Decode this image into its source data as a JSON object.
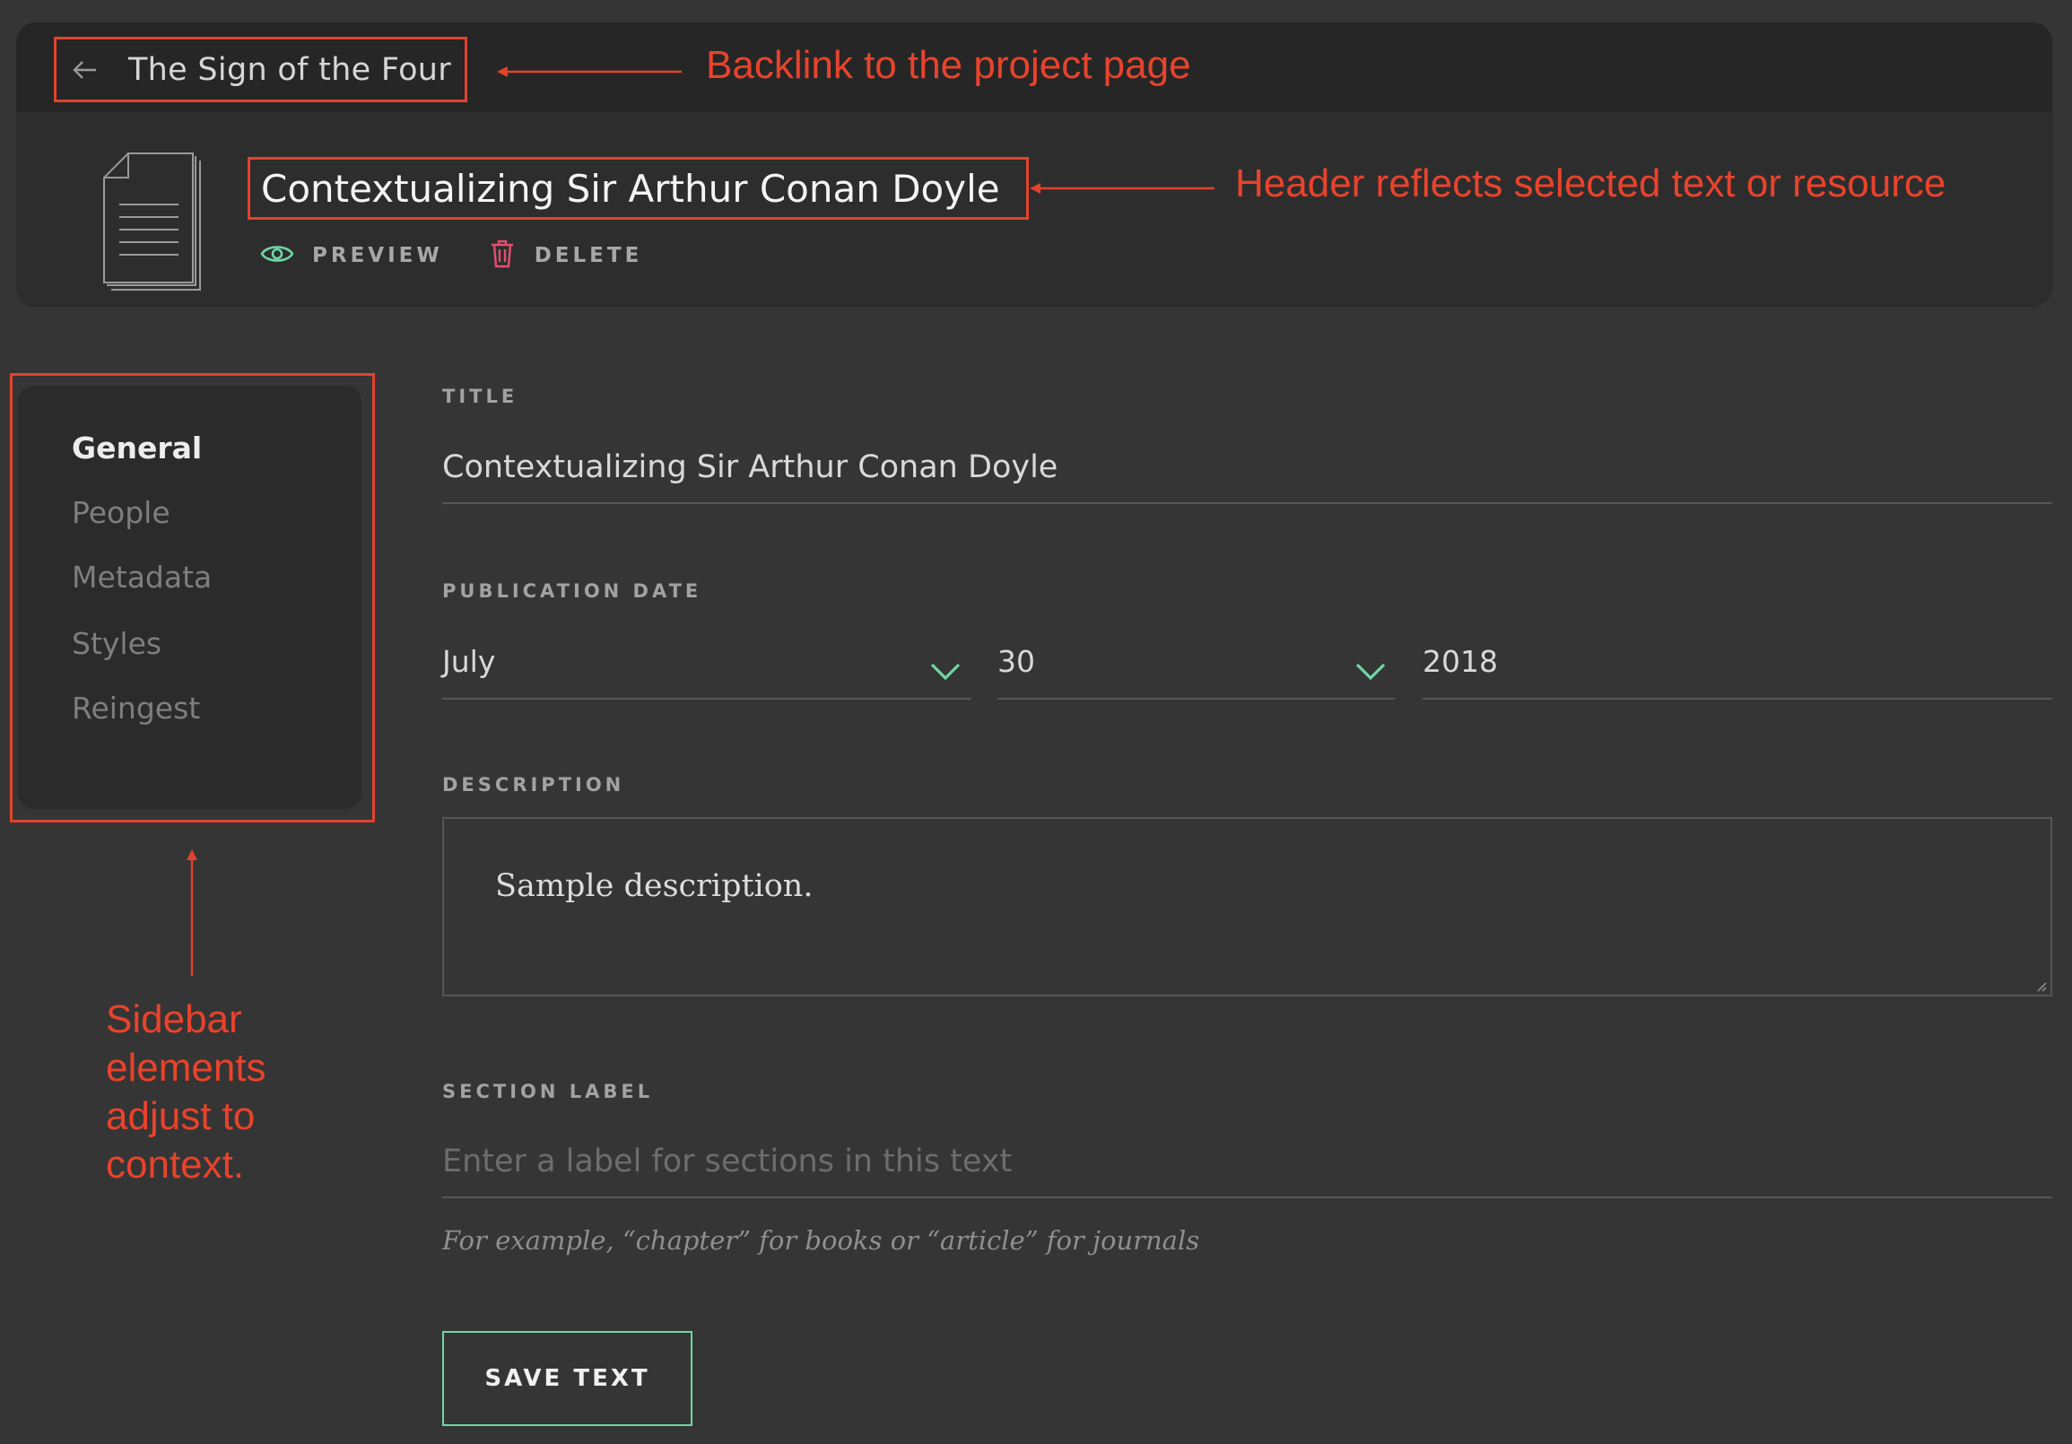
{
  "header": {
    "backlink_label": "The Sign of the Four",
    "title": "Contextualizing Sir Arthur Conan Doyle",
    "actions": {
      "preview_label": "PREVIEW",
      "delete_label": "DELETE"
    }
  },
  "annotations": {
    "backlink": "Backlink to the project page",
    "header": "Header reflects selected text or resource",
    "sidebar_lines": [
      "Sidebar",
      "elements",
      "adjust to",
      "context."
    ]
  },
  "sidebar": {
    "items": [
      {
        "label": "General",
        "active": true
      },
      {
        "label": "People",
        "active": false
      },
      {
        "label": "Metadata",
        "active": false
      },
      {
        "label": "Styles",
        "active": false
      },
      {
        "label": "Reingest",
        "active": false
      }
    ]
  },
  "form": {
    "title": {
      "label": "TITLE",
      "value": "Contextualizing Sir Arthur Conan Doyle"
    },
    "publication_date": {
      "label": "PUBLICATION DATE",
      "month": "July",
      "day": "30",
      "year": "2018"
    },
    "description": {
      "label": "DESCRIPTION",
      "value": "Sample description."
    },
    "section_label": {
      "label": "SECTION LABEL",
      "placeholder": "Enter a label for sections in this text",
      "value": "",
      "hint": "For example, “chapter” for books or “article” for journals"
    },
    "save_label": "SAVE TEXT"
  },
  "colors": {
    "annotation": "#e2432c",
    "accent_green": "#6fd6a6",
    "delete_pink": "#e0506f",
    "background": "#353535"
  }
}
